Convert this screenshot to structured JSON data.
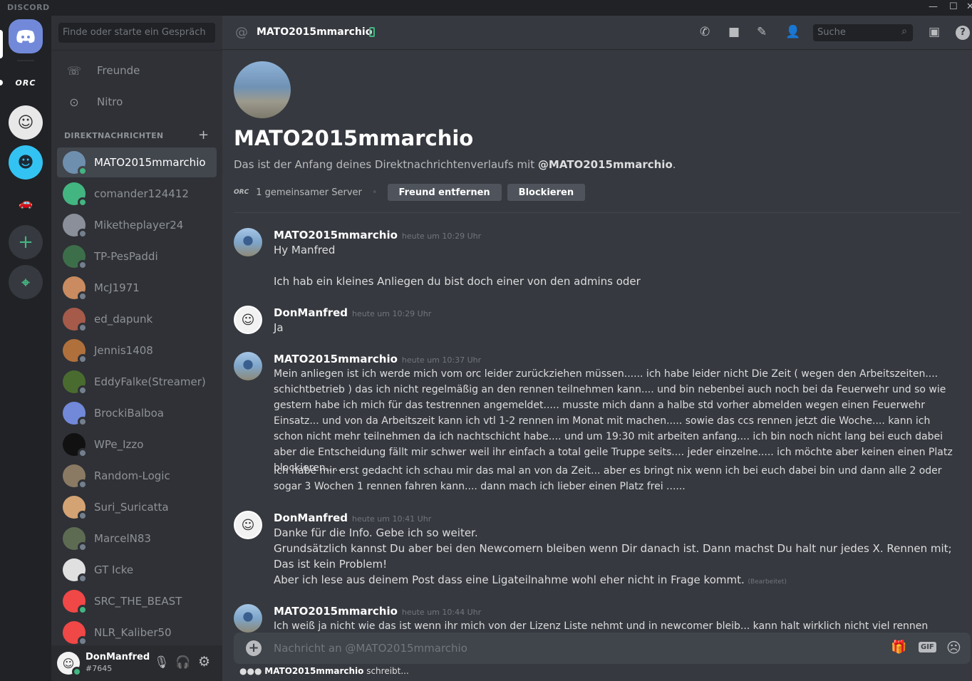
{
  "window": {
    "brand": "DISCORD",
    "minimize": "—",
    "maximize": "☐",
    "close": "✕"
  },
  "guilds": [
    {
      "name": "discord-home",
      "label": "",
      "color": "#7289da"
    },
    {
      "name": "orc-server",
      "label": "ORC",
      "color": "#202225"
    },
    {
      "name": "server-meme",
      "label": "",
      "color": "#e8e8e8"
    },
    {
      "name": "server-blue-face",
      "label": "",
      "color": "#33c3f3"
    },
    {
      "name": "server-car",
      "label": "",
      "color": "#202225"
    }
  ],
  "sidebar": {
    "search_placeholder": "Finde oder starte ein Gespräch",
    "nav": [
      {
        "label": "Freunde",
        "icon": "friends-icon"
      },
      {
        "label": "Nitro",
        "icon": "nitro-icon"
      }
    ],
    "dm_header": "DIREKTNACHRICHTEN",
    "dms": [
      {
        "name": "MATO2015mmarchio",
        "color": "#6f8fae",
        "status": "#43b581",
        "active": true
      },
      {
        "name": "comander124412",
        "color": "#43b581",
        "status": "#43b581"
      },
      {
        "name": "Miketheplayer24",
        "color": "#8a8f99",
        "status": "#747f8d"
      },
      {
        "name": "TP-PesPaddi",
        "color": "#3c6e4a",
        "status": "#747f8d"
      },
      {
        "name": "McJ1971",
        "color": "#c98b5f",
        "status": "#747f8d"
      },
      {
        "name": "ed_dapunk",
        "color": "#a55a4a",
        "status": "#747f8d"
      },
      {
        "name": "Jennis1408",
        "color": "#b0703c",
        "status": "#747f8d"
      },
      {
        "name": "EddyFalke(Streamer)",
        "color": "#4a6b2f",
        "status": "#747f8d"
      },
      {
        "name": "BrockiBalboa",
        "color": "#7289da",
        "status": "#747f8d"
      },
      {
        "name": "WPe_Izzo",
        "color": "#111111",
        "status": "#747f8d"
      },
      {
        "name": "Random-Logic",
        "color": "#8a7a63",
        "status": "#747f8d"
      },
      {
        "name": "Suri_Suricatta",
        "color": "#d4a373",
        "status": "#747f8d"
      },
      {
        "name": "MarcelN83",
        "color": "#5d6b52",
        "status": "#747f8d"
      },
      {
        "name": "GT Icke",
        "color": "#e0e0e0",
        "status": "#747f8d"
      },
      {
        "name": "SRC_THE_BEAST",
        "color": "#f04747",
        "status": "#43b581"
      },
      {
        "name": "NLR_Kaliber50",
        "color": "#f04747",
        "status": "#747f8d"
      }
    ]
  },
  "user": {
    "name": "DonManfred",
    "tag": "#7645"
  },
  "header": {
    "name": "MATO2015mmarchio",
    "search_placeholder": "Suche"
  },
  "intro": {
    "title": "MATO2015mmarchio",
    "subtitle_prefix": "Das ist der Anfang deines Direktnachrichtenverlaufs mit ",
    "subtitle_user": "@MATO2015mmarchio",
    "subtitle_suffix": ".",
    "mutual": "1 gemeinsamer Server",
    "remove_friend": "Freund entfernen",
    "block": "Blockieren"
  },
  "messages": [
    {
      "user": "MATO2015mmarchio",
      "time": "heute um 10:29 Uhr",
      "lines": [
        "Hy Manfred",
        "",
        "Ich hab ein kleines Anliegen du bist doch einer von den admins oder"
      ]
    },
    {
      "user": "DonManfred",
      "time": "heute um 10:29 Uhr",
      "lines": [
        "Ja"
      ]
    },
    {
      "user": "MATO2015mmarchio",
      "time": "heute um 10:37 Uhr",
      "lines": [
        "Mein anliegen ist ich werde mich vom orc leider zurückziehen  müssen...... ich  habe leider nicht Die Zeit ( wegen den Arbeitszeiten.... schichtbetrieb ) das ich nicht regelmäßig an den rennen teilnehmen kann.... und bin nebenbei auch noch bei da Feuerwehr und so wie gestern habe ich mich für das testrennen angemeldet..... musste mich dann a halbe std vorher abmelden wegen einen Feuerwehr Einsatz... und von da Arbeitszeit kann ich vtl 1-2 rennen im Monat mit machen..... sowie das ccs rennen jetzt die Woche.... kann ich schon nicht mehr teilnehmen da ich nachtschicht habe.... und um 19:30 mit arbeiten anfang.... ich bin noch nicht lang bei euch dabei aber die Entscheidung fällt mir schwer weil ihr einfach a total geile Truppe seits....  jeder einzelne..... ich möchte aber keinen einen Platz blockieren......",
        "Ich habe mir erst gedacht ich schau mir das mal an von da Zeit... aber es bringt nix wenn ich bei euch dabei bin und dann alle 2 oder sogar 3 Wochen 1 rennen fahren kann.... dann mach ich lieber einen Platz frei ......"
      ]
    },
    {
      "user": "DonManfred",
      "time": "heute um 10:41 Uhr",
      "lines": [
        "Danke für die Info. Gebe ich so weiter.",
        "Grundsätzlich kannst Du aber bei den Newcomern bleiben wenn Dir danach ist. Dann machst Du halt nur jedes X. Rennen mit; Das ist kein Problem!",
        "Aber ich lese aus deinem Post dass eine Ligateilnahme wohl eher nicht in Frage kommt."
      ],
      "edited": "(Bearbeitet)"
    },
    {
      "user": "MATO2015mmarchio",
      "time": "heute um 10:44 Uhr",
      "lines": [
        "Ich weiß ja nicht wie das ist wenn ihr mich von der Lizenz Liste nehmt und in newcomer bleib...  kann halt wirklich nicht viel rennen"
      ]
    }
  ],
  "composer": {
    "placeholder": "Nachricht an @MATO2015mmarchio",
    "gif": "GIF"
  },
  "typing": {
    "user": "MATO2015mmarchio",
    "suffix": " schreibt..."
  }
}
